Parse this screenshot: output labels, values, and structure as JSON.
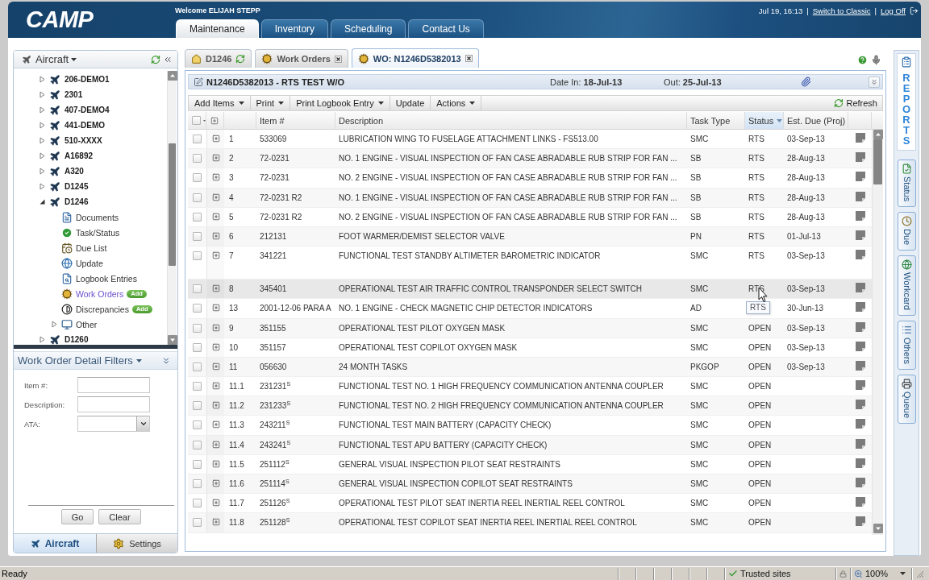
{
  "header": {
    "logo": "CAMP",
    "welcome": "Welcome ELIJAH STEPP",
    "links": [
      {
        "kind": "text",
        "label": "Jul 19, 16:13"
      },
      {
        "kind": "separator",
        "label": "|"
      },
      {
        "kind": "link",
        "label": "Switch to Classic"
      },
      {
        "kind": "separator",
        "label": "|"
      },
      {
        "kind": "link",
        "label": "Log Off"
      }
    ]
  },
  "nav_tabs": [
    {
      "label": "Maintenance",
      "selected": true
    },
    {
      "label": "Inventory",
      "selected": false
    },
    {
      "label": "Scheduling",
      "selected": false
    },
    {
      "label": "Contact Us",
      "selected": false
    }
  ],
  "sidebar": {
    "title": "Aircraft",
    "tree": [
      {
        "label": "206-DEMO1",
        "expanded": false
      },
      {
        "label": "2301",
        "expanded": false
      },
      {
        "label": "407-DEMO4",
        "expanded": false
      },
      {
        "label": "441-DEMO",
        "expanded": false
      },
      {
        "label": "510-XXXX",
        "expanded": false
      },
      {
        "label": "A16892",
        "expanded": false
      },
      {
        "label": "A320",
        "expanded": false
      },
      {
        "label": "D1245",
        "expanded": false
      },
      {
        "label": "D1246",
        "expanded": true,
        "children": [
          {
            "label": "Documents",
            "kind": "documents",
            "selected": false
          },
          {
            "label": "Task/Status",
            "kind": "status",
            "selected": false
          },
          {
            "label": "Due List",
            "kind": "due",
            "selected": false
          },
          {
            "label": "Update",
            "kind": "update",
            "selected": false
          },
          {
            "label": "Logbook Entries",
            "kind": "logbook",
            "selected": false
          },
          {
            "label": "Work Orders",
            "kind": "workorders",
            "selected": true,
            "badge": "Add"
          },
          {
            "label": "Discrepancies",
            "kind": "discrepancies",
            "selected": false,
            "badge": "Add"
          },
          {
            "label": "Other",
            "kind": "folder",
            "selected": false,
            "expanded": false
          }
        ]
      },
      {
        "label": "D1260",
        "expanded": false
      }
    ],
    "filters": {
      "title": "Work Order Detail Filters",
      "fields": [
        {
          "label": "Item #:",
          "kind": "text"
        },
        {
          "label": "Description:",
          "kind": "text"
        },
        {
          "label": "ATA:",
          "kind": "select"
        }
      ],
      "buttons": [
        "Go",
        "Clear"
      ]
    },
    "bottom_tabs": [
      {
        "label": "Aircraft",
        "kind": "aircraft",
        "selected": true
      },
      {
        "label": "Settings",
        "kind": "settings",
        "selected": false
      }
    ]
  },
  "workspace": {
    "tabs": [
      {
        "label": "D1246",
        "kind": "home",
        "selected": false,
        "closable": false
      },
      {
        "label": "Work Orders",
        "kind": "workorders",
        "selected": false,
        "closable": true
      },
      {
        "label": "WO: N1246D5382013",
        "kind": "workorders",
        "selected": true,
        "closable": true
      }
    ]
  },
  "work_order": {
    "title": "N1246D5382013 - RTS TEST W/O",
    "date_in": "Date In: **18-Jul-13**",
    "date_out": "Out: **25-Jul-13**"
  },
  "toolbar": {
    "items": [
      {
        "label": "Add Items",
        "menu": true
      },
      {
        "label": "Print",
        "menu": true
      },
      {
        "label": "Print Logbook Entry",
        "menu": true
      },
      {
        "label": "Update",
        "menu": false
      },
      {
        "label": "Actions",
        "menu": true
      }
    ],
    "refresh": "Refresh"
  },
  "table": {
    "all_checked": false,
    "columns": [
      {
        "label": "Item #",
        "sorted": false
      },
      {
        "label": "Description",
        "sorted": false
      },
      {
        "label": "Task Type",
        "sorted": false
      },
      {
        "label": "Status",
        "sorted": true
      },
      {
        "label": "Est. Due (Proj)",
        "sorted": false
      }
    ],
    "rows": [
      {
        "no": "1",
        "item": "533069",
        "description": "LUBRICATION WING TO FUSELAGE ATTACHMENT LINKS - FS513.00",
        "task_type": "SMC",
        "status": "RTS",
        "due": "03-Sep-13",
        "checked": false,
        "hovered": false,
        "tall": false
      },
      {
        "no": "2",
        "item": "72-0231",
        "description": "NO. 1 ENGINE - VISUAL INSPECTION OF FAN CASE ABRADABLE RUB STRIP FOR FAN ...",
        "task_type": "SB",
        "status": "RTS",
        "due": "28-Aug-13",
        "checked": false,
        "hovered": false,
        "tall": false
      },
      {
        "no": "3",
        "item": "72-0231",
        "description": "NO. 2 ENGINE - VISUAL INSPECTION OF FAN CASE ABRADABLE RUB STRIP FOR FAN ...",
        "task_type": "SB",
        "status": "RTS",
        "due": "28-Aug-13",
        "checked": false,
        "hovered": false,
        "tall": false
      },
      {
        "no": "4",
        "item": "72-0231 R2",
        "description": "NO. 1 ENGINE - VISUAL INSPECTION OF FAN CASE ABRADABLE RUB STRIP FOR FAN ...",
        "task_type": "SB",
        "status": "RTS",
        "due": "28-Aug-13",
        "checked": false,
        "hovered": false,
        "tall": false
      },
      {
        "no": "5",
        "item": "72-0231 R2",
        "description": "NO. 2 ENGINE - VISUAL INSPECTION OF FAN CASE ABRADABLE RUB STRIP FOR FAN ...",
        "task_type": "SB",
        "status": "RTS",
        "due": "28-Aug-13",
        "checked": false,
        "hovered": false,
        "tall": false
      },
      {
        "no": "6",
        "item": "212131",
        "description": "FOOT WARMER/DEMIST SELECTOR VALVE",
        "task_type": "PN",
        "status": "RTS",
        "due": "01-Jul-13",
        "checked": false,
        "hovered": false,
        "tall": false
      },
      {
        "no": "7",
        "item": "341221",
        "description": "FUNCTIONAL TEST STANDBY ALTIMETER BAROMETRIC INDICATOR",
        "task_type": "SMC",
        "status": "RTS",
        "due": "03-Sep-13",
        "checked": false,
        "hovered": false,
        "tall": true
      },
      {
        "no": "8",
        "item": "345401",
        "description": "OPERATIONAL TEST AIR TRAFFIC CONTROL TRANSPONDER SELECT SWITCH",
        "task_type": "SMC",
        "status": "RTS",
        "due": "03-Sep-13",
        "checked": false,
        "hovered": true,
        "tall": false,
        "tooltip": "RTS"
      },
      {
        "no": "13",
        "item": "2001-12-06 PARA A",
        "description": "NO. 1 ENGINE - CHECK MAGNETIC CHIP DETECTOR INDICATORS",
        "task_type": "AD",
        "due": "30-Jun-13",
        "checked": false,
        "hovered": false,
        "tall": false
      },
      {
        "no": "9",
        "item": "351155",
        "description": "OPERATIONAL TEST PILOT OXYGEN MASK",
        "task_type": "SMC",
        "status": "OPEN",
        "due": "03-Sep-13",
        "checked": false,
        "hovered": false,
        "tall": false
      },
      {
        "no": "10",
        "item": "351157",
        "description": "OPERATIONAL TEST COPILOT OXYGEN MASK",
        "task_type": "SMC",
        "status": "OPEN",
        "due": "03-Sep-13",
        "checked": false,
        "hovered": false,
        "tall": false
      },
      {
        "no": "11",
        "item": "056630",
        "description": "24 MONTH TASKS",
        "task_type": "PKGOP",
        "status": "OPEN",
        "due": "03-Sep-13",
        "checked": false,
        "hovered": false,
        "tall": false
      },
      {
        "no": "11.1",
        "item": "231231$^{S}$",
        "description": "FUNCTIONAL TEST NO. 1 HIGH FREQUENCY COMMUNICATION ANTENNA COUPLER",
        "task_type": "SMC",
        "status": "OPEN",
        "checked": false,
        "hovered": false,
        "tall": false
      },
      {
        "no": "11.2",
        "item": "231233$^{S}$",
        "description": "FUNCTIONAL TEST NO. 2 HIGH FREQUENCY COMMUNICATION ANTENNA COUPLER",
        "task_type": "SMC",
        "status": "OPEN",
        "checked": false,
        "hovered": false,
        "tall": false
      },
      {
        "no": "11.3",
        "item": "243211$^{S}$",
        "description": "FUNCTIONAL TEST MAIN BATTERY (CAPACITY CHECK)",
        "task_type": "SMC",
        "status": "OPEN",
        "checked": false,
        "hovered": false,
        "tall": false
      },
      {
        "no": "11.4",
        "item": "243241$^{S}$",
        "description": "FUNCTIONAL TEST APU BATTERY (CAPACITY CHECK)",
        "task_type": "SMC",
        "status": "OPEN",
        "checked": false,
        "hovered": false,
        "tall": false
      },
      {
        "no": "11.5",
        "item": "251112$^{S}$",
        "description": "GENERAL VISUAL INSPECTION PILOT SEAT RESTRAINTS",
        "task_type": "SMC",
        "status": "OPEN",
        "checked": false,
        "hovered": false,
        "tall": false
      },
      {
        "no": "11.6",
        "item": "251114$^{S}$",
        "description": "GENERAL VISUAL INSPECTION COPILOT SEAT RESTRAINTS",
        "task_type": "SMC",
        "status": "OPEN",
        "checked": false,
        "hovered": false,
        "tall": false
      },
      {
        "no": "11.7",
        "item": "251126$^{S}$",
        "description": "OPERATIONAL TEST PILOT SEAT INERTIA REEL INERTIAL REEL CONTROL",
        "task_type": "SMC",
        "status": "OPEN",
        "checked": false,
        "hovered": false,
        "tall": false
      },
      {
        "no": "11.8",
        "item": "251128$^{S}$",
        "description": "OPERATIONAL TEST COPILOT SEAT INERTIA REEL INERTIAL REEL CONTROL",
        "task_type": "SMC",
        "status": "OPEN",
        "checked": false,
        "hovered": false,
        "tall": false
      }
    ]
  },
  "right_rail": {
    "reports": "REPORTS",
    "tabs": [
      {
        "label": "Status",
        "kind": "status"
      },
      {
        "label": "Due",
        "kind": "due"
      },
      {
        "label": "Workcard",
        "kind": "workcard"
      },
      {
        "label": "Others",
        "kind": "others"
      },
      {
        "label": "Queue",
        "kind": "queue"
      }
    ]
  },
  "status_bar": {
    "text": "Ready",
    "zone": "Trusted sites",
    "zoom": "100%"
  }
}
